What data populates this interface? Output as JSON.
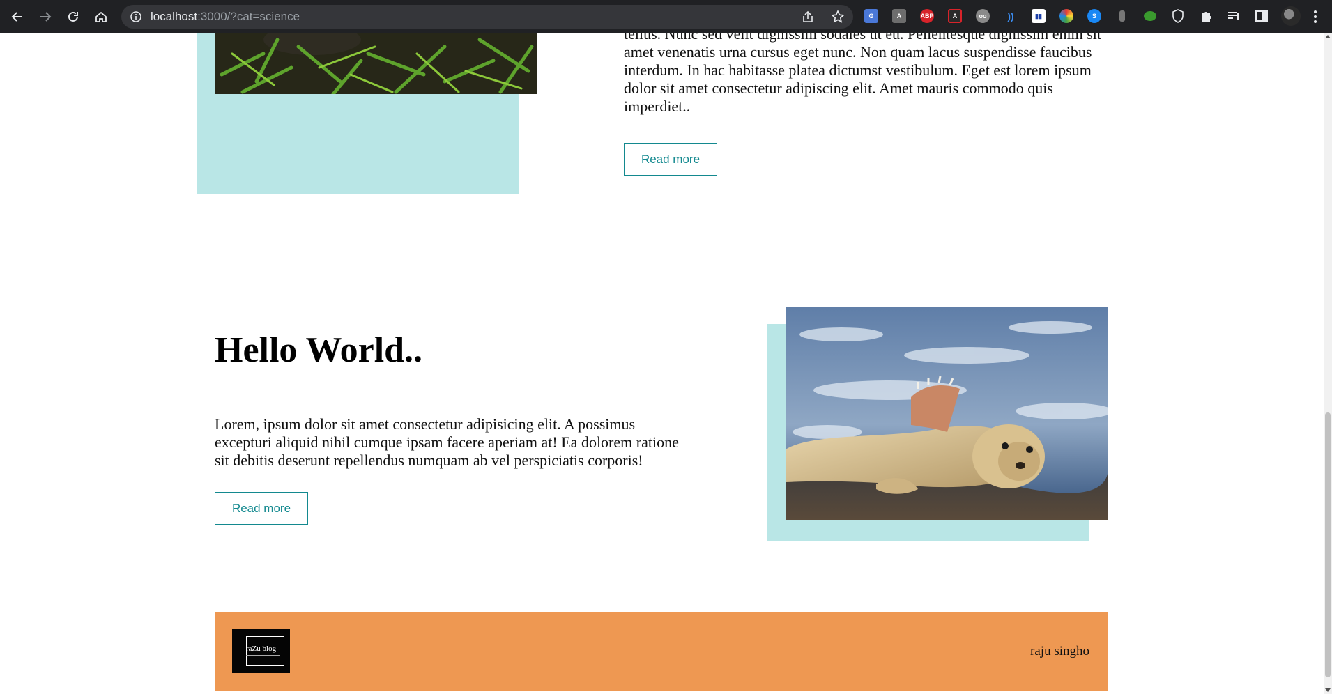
{
  "browser": {
    "url_host": "localhost",
    "url_rest": ":3000/?cat=science",
    "extensions": [
      "google-translate",
      "a-text",
      "adblock-plus",
      "adobe-pdf",
      "spy-glasses",
      "waves",
      "flag",
      "color-wheel",
      "shazam",
      "bottle",
      "tree",
      "shield",
      "puzzle",
      "reading-list",
      "side-panel"
    ]
  },
  "post1": {
    "text": "tellus. Nunc sed velit dignissim sodales ut eu. Pellentesque dignissim enim sit amet venenatis urna cursus eget nunc. Non quam lacus suspendisse faucibus interdum. In hac habitasse platea dictumst vestibulum. Eget est lorem ipsum dolor sit amet consectetur adipiscing elit. Amet mauris commodo quis imperdiet..",
    "button": "Read more"
  },
  "post2": {
    "title": "Hello World..",
    "text": "Lorem, ipsum dolor sit amet consectetur adipisicing elit. A possimus excepturi aliquid nihil cumque ipsam facere aperiam at! Ea dolorem ratione sit debitis deserunt repellendus numquam ab vel perspiciatis corporis!",
    "button": "Read more"
  },
  "footer": {
    "logo_text": "raZu blog",
    "author": "raju singho"
  },
  "colors": {
    "accent": "#13898f",
    "image_backdrop": "#b9e6e6",
    "footer": "#ee9852"
  }
}
